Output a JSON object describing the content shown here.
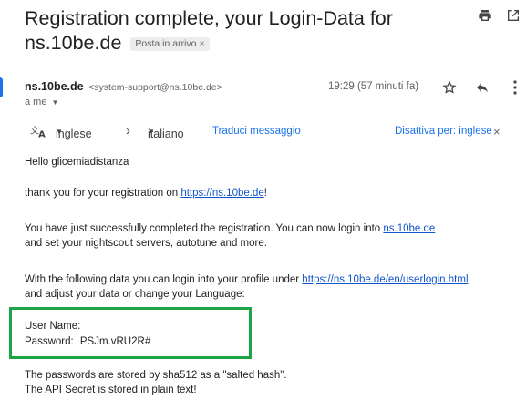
{
  "email": {
    "subject_line1": "Registration complete, your Login-Data for",
    "subject_line2": "ns.10be.de",
    "label_badge": "Posta in arrivo",
    "badge_close": "×",
    "sender_name": "ns.10be.de",
    "sender_email": "<system-support@ns.10be.de>",
    "recipient": "a me",
    "time": "19:29 (57 minuti fa)"
  },
  "translation": {
    "from_lang": "inglese",
    "to_lang": "italiano",
    "translate_link": "Traduci messaggio",
    "disable_link": "Disattiva per: inglese",
    "close": "×"
  },
  "body": {
    "greeting": "Hello glicemiadistanza",
    "p1_pre": "thank you for your registration on ",
    "p1_link": "https://ns.10be.de",
    "p1_post": "!",
    "p2_pre": "You have just successfully completed the registration. You can now login into ",
    "p2_link": "ns.10be.de",
    "p2_line2": "and set your nightscout servers, autotune and more.",
    "p3_pre": "With the following data you can login into your profile under ",
    "p3_link": "https://ns.10be.de/en/userlogin.html",
    "p3_line2": "and adjust your data or change your Language:",
    "username_label": "User Name:",
    "password_label": "Password:",
    "password_value": "PSJm.vRU2R#",
    "p5_line1": "The passwords are stored by sha512 as a \"salted hash\".",
    "p5_line2": "The API Secret is stored in plain text!"
  },
  "colors": {
    "highlight_box": "#1fa347",
    "link": "#1155cc",
    "accent": "#1a73e8"
  }
}
